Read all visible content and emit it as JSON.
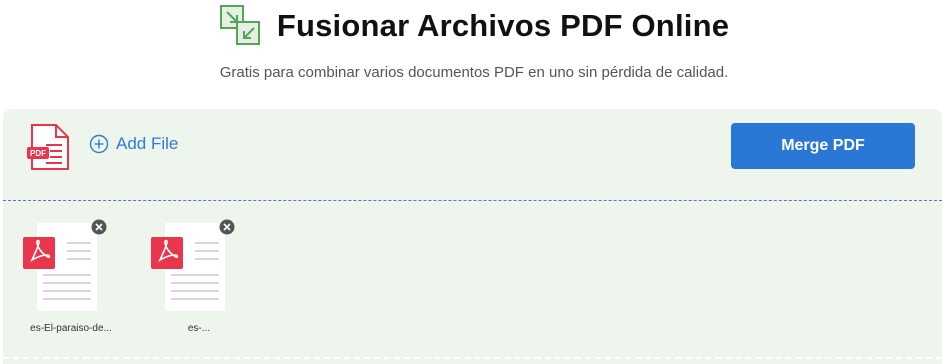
{
  "header": {
    "logo_icon": "merge-arrows-icon",
    "title": "Fusionar Archivos PDF Online",
    "subtitle": "Gratis para combinar varios documentos PDF en uno sin pérdida de calidad."
  },
  "toolbar": {
    "pdf_icon": "pdf-file-icon",
    "pdf_icon_text": "PDF",
    "add_file_label": "Add File",
    "merge_label": "Merge PDF"
  },
  "files": [
    {
      "name": "es-El-paraiso-de...",
      "icon": "pdf-document-icon"
    },
    {
      "name": "es-...",
      "icon": "pdf-document-icon"
    }
  ],
  "colors": {
    "accent": "#2b77d6",
    "panel_bg": "#eef5ec",
    "pdf_red": "#e8374d",
    "logo_green": "#58a35b"
  }
}
